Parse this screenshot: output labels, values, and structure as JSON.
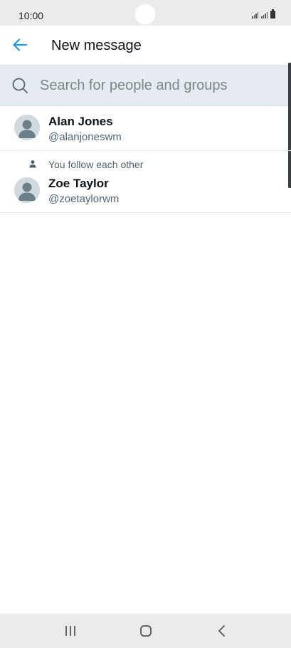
{
  "status_bar": {
    "time": "10:00",
    "icons": [
      "signal-icon",
      "signal-icon",
      "battery-icon"
    ]
  },
  "header": {
    "title": "New message",
    "back_icon": "arrow-left-icon",
    "accent_color": "#1d9bf0"
  },
  "search": {
    "placeholder": "Search for people and groups",
    "value": "",
    "icon": "search-icon"
  },
  "users": [
    {
      "name": "Alan Jones",
      "handle": "@alanjoneswm",
      "note": ""
    },
    {
      "name": "Zoe Taylor",
      "handle": "@zoetaylorwm",
      "note": "You follow each other"
    }
  ],
  "nav_bar": {
    "buttons": [
      "recents-icon",
      "home-icon",
      "back-icon"
    ]
  }
}
